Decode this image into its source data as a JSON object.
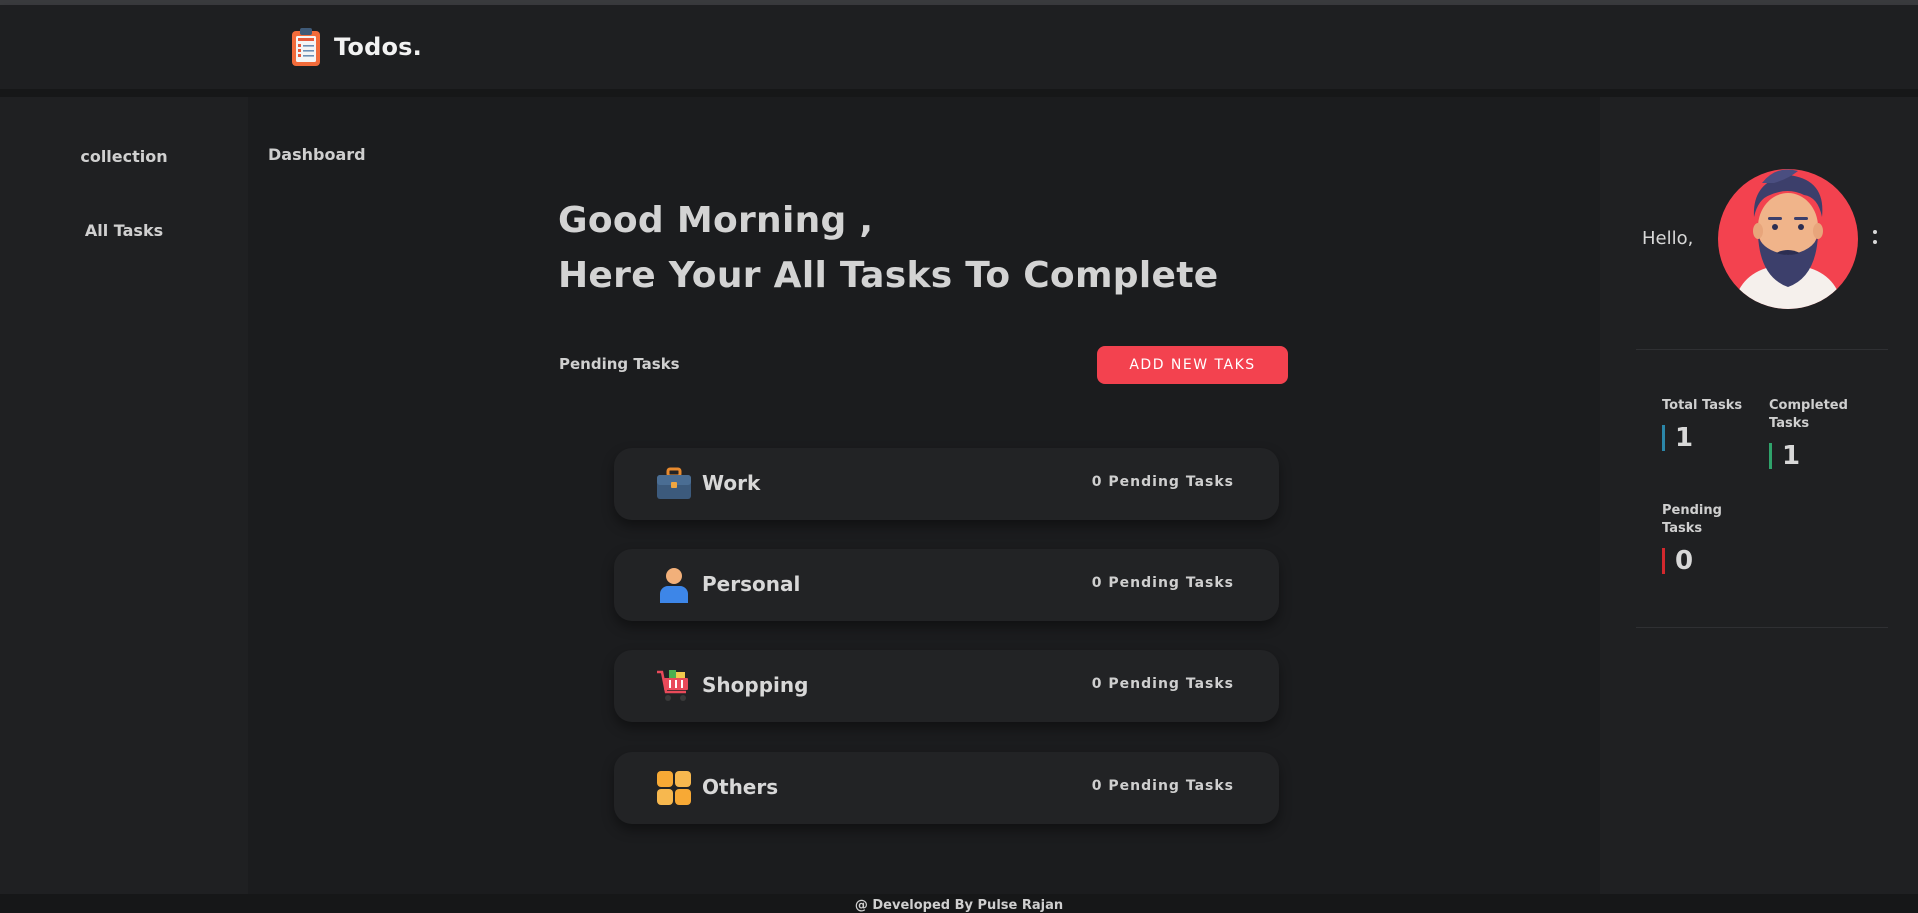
{
  "header": {
    "title": "Todos.",
    "logo_icon": "clipboard-todo-icon"
  },
  "sidebar": {
    "items": [
      {
        "label": "collection"
      },
      {
        "label": "All Tasks"
      }
    ]
  },
  "main": {
    "breadcrumb": "Dashboard",
    "greeting_line1": "Good Morning ,",
    "greeting_line2": "Here Your All Tasks To Complete",
    "pending_heading": "Pending Tasks",
    "add_button_label": "ADD NEW TAKS",
    "categories": [
      {
        "name": "Work",
        "pending": "0 Pending Tasks",
        "icon": "briefcase-icon"
      },
      {
        "name": "Personal",
        "pending": "0 Pending Tasks",
        "icon": "person-icon"
      },
      {
        "name": "Shopping",
        "pending": "0 Pending Tasks",
        "icon": "shopping-cart-icon"
      },
      {
        "name": "Others",
        "pending": "0 Pending Tasks",
        "icon": "grid-icon"
      }
    ]
  },
  "profile": {
    "hello": "Hello,",
    "avatar_icon": "bearded-man-avatar",
    "stats": [
      {
        "label": "Total Tasks",
        "value": "1",
        "color": "#2b86a8"
      },
      {
        "label": "Completed Tasks",
        "value": "1",
        "color": "#2fa36b"
      },
      {
        "label": "Pending Tasks",
        "value": "0",
        "color": "#d2282d"
      }
    ]
  },
  "footer": {
    "text": "@ Developed By Pulse Rajan"
  },
  "colors": {
    "accent": "#f3424f",
    "background": "#1c1d1f",
    "panel": "#1f2022",
    "card": "#222325"
  }
}
